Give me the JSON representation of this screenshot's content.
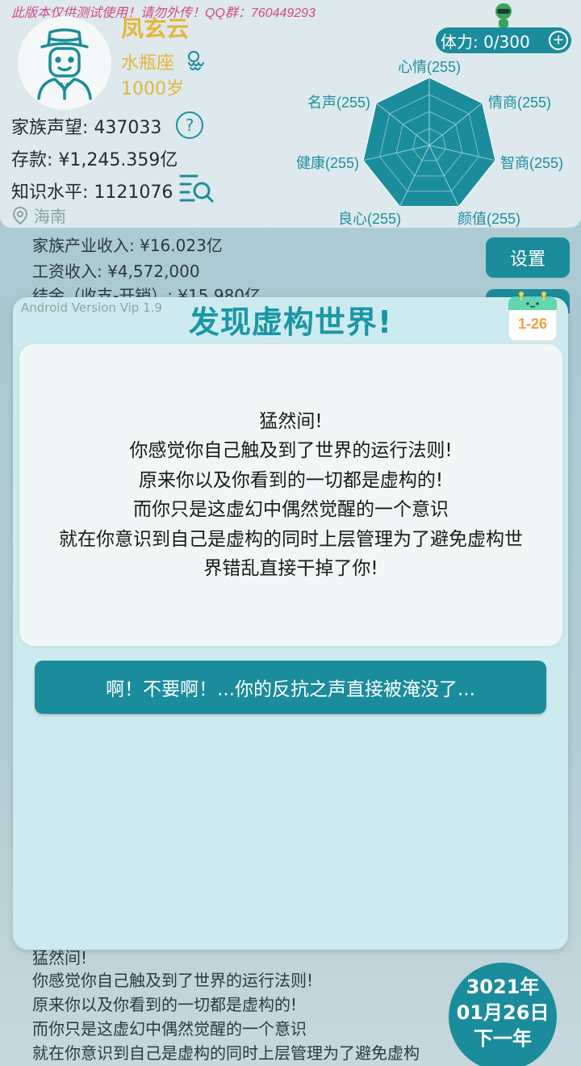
{
  "header": {
    "notice": "此版本仅供测试使用！请勿外传！QQ群：760449293",
    "name": "凤玄云",
    "zodiac": "水瓶座",
    "age": "1000岁",
    "reputation": "家族声望: 437033",
    "savings": "存款: ¥1,245.359亿",
    "knowledge": "知识水平: 1121076",
    "location": "海南",
    "stamina": "体力: 0/300",
    "colors": {
      "accent": "#1b8c9b",
      "gold": "#e6b53a",
      "notice": "#d24a8a"
    }
  },
  "radar": {
    "labels": {
      "mood": "心情(255)",
      "eq": "情商(255)",
      "iq": "智商(255)",
      "looks": "颜值(255)",
      "conscience": "良心(255)",
      "health": "健康(255)",
      "fame": "名声(255)"
    },
    "values": [
      255,
      255,
      255,
      255,
      255,
      255,
      255
    ],
    "max": 255
  },
  "background": {
    "income_industry": "家族产业收入: ¥16.023亿",
    "income_salary": "工资收入: ¥4,572,000",
    "balance": "结余（收支-开销）: ¥15.980亿",
    "settings_label": "设置",
    "log": [
      "猛然间!",
      "你感觉你自己触及到了世界的运行法则!",
      "原来你以及你看到的一切都是虚构的!",
      "而你只是这虚幻中偶然觉醒的一个意识",
      "就在你意识到自己是虚构的同时上层管理为了避免虚构"
    ],
    "date_year": "3021年",
    "date_day": "01月26日",
    "next_year": "下一年"
  },
  "modal": {
    "version": "Android Version Vip 1.9",
    "title": "发现虚构世界!",
    "calendar_date": "1-26",
    "story": [
      "猛然间!",
      "你感觉你自己触及到了世界的运行法则!",
      "原来你以及你看到的一切都是虚构的!",
      "而你只是这虚幻中偶然觉醒的一个意识",
      "就在你意识到自己是虚构的同时上层管理为了避免虚构世",
      "界错乱直接干掉了你!"
    ],
    "choice": "啊！不要啊！...你的反抗之声直接被淹没了..."
  }
}
